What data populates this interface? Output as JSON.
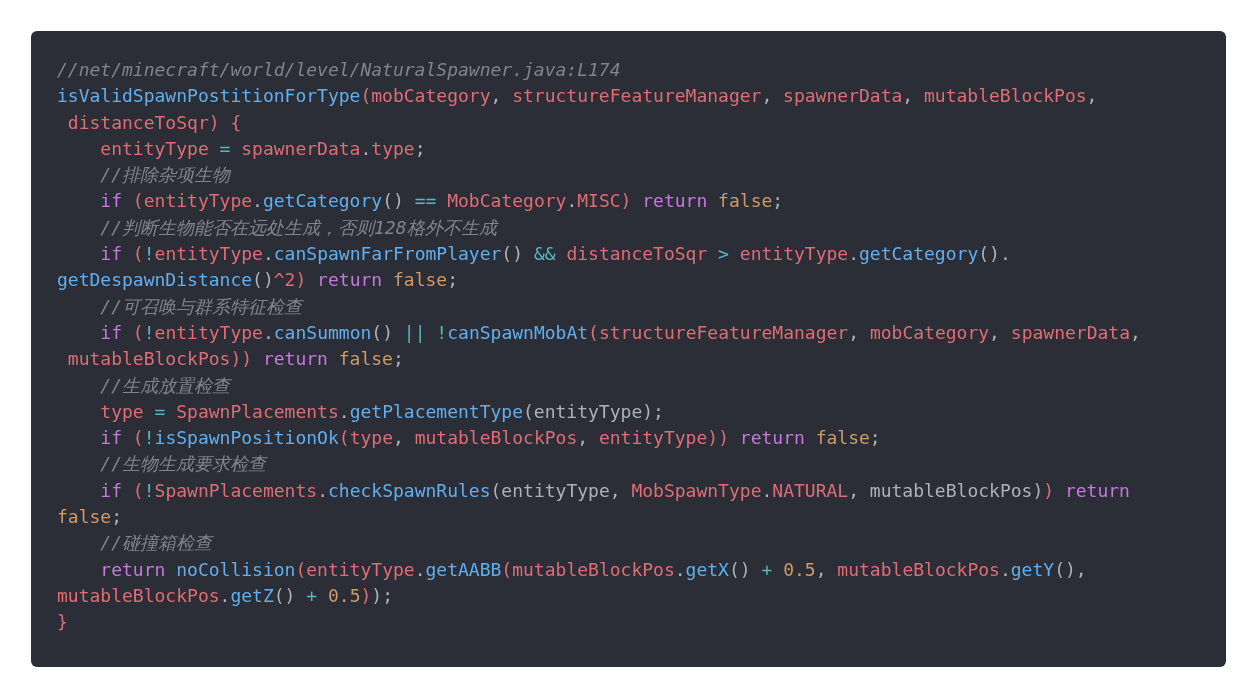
{
  "code_block": {
    "lines": [
      {
        "tokens": [
          {
            "kind": "comment",
            "text": "//net/minecraft/world/level/NaturalSpawner.java:L174"
          }
        ]
      },
      {
        "tokens": [
          {
            "kind": "fn",
            "text": "isValidSpawnPostitionForType"
          },
          {
            "kind": "var",
            "text": "(mobCategory"
          },
          {
            "kind": "plain",
            "text": ", "
          },
          {
            "kind": "var",
            "text": "structureFeatureManager"
          },
          {
            "kind": "plain",
            "text": ", "
          },
          {
            "kind": "var",
            "text": "spawnerData"
          },
          {
            "kind": "plain",
            "text": ", "
          },
          {
            "kind": "var",
            "text": "mutableBlockPos"
          },
          {
            "kind": "plain",
            "text": ","
          }
        ]
      },
      {
        "tokens": [
          {
            "kind": "var",
            "text": " distanceToSqr) {"
          }
        ]
      },
      {
        "tokens": [
          {
            "kind": "var",
            "text": "    entityType"
          },
          {
            "kind": "op",
            "text": " = "
          },
          {
            "kind": "var",
            "text": "spawnerData"
          },
          {
            "kind": "plain",
            "text": "."
          },
          {
            "kind": "var",
            "text": "type"
          },
          {
            "kind": "plain",
            "text": ";"
          }
        ]
      },
      {
        "tokens": [
          {
            "kind": "comment",
            "text": "    //排除杂项生物"
          }
        ]
      },
      {
        "tokens": [
          {
            "kind": "kw",
            "text": "    if"
          },
          {
            "kind": "var",
            "text": " (entityType"
          },
          {
            "kind": "plain",
            "text": "."
          },
          {
            "kind": "fn",
            "text": "getCategory"
          },
          {
            "kind": "plain",
            "text": "() "
          },
          {
            "kind": "op",
            "text": "=="
          },
          {
            "kind": "var",
            "text": " MobCategory"
          },
          {
            "kind": "plain",
            "text": "."
          },
          {
            "kind": "var",
            "text": "MISC)"
          },
          {
            "kind": "kw",
            "text": " return"
          },
          {
            "kind": "lit",
            "text": " false"
          },
          {
            "kind": "plain",
            "text": ";"
          }
        ]
      },
      {
        "tokens": [
          {
            "kind": "comment",
            "text": "    //判断生物能否在远处生成，否则128格外不生成"
          }
        ]
      },
      {
        "tokens": [
          {
            "kind": "kw",
            "text": "    if"
          },
          {
            "kind": "var",
            "text": " ("
          },
          {
            "kind": "op",
            "text": "!"
          },
          {
            "kind": "var",
            "text": "entityType"
          },
          {
            "kind": "plain",
            "text": "."
          },
          {
            "kind": "fn",
            "text": "canSpawnFarFromPlayer"
          },
          {
            "kind": "plain",
            "text": "() "
          },
          {
            "kind": "op",
            "text": "&&"
          },
          {
            "kind": "var",
            "text": " distanceToSqr"
          },
          {
            "kind": "op",
            "text": " > "
          },
          {
            "kind": "var",
            "text": "entityType"
          },
          {
            "kind": "plain",
            "text": "."
          },
          {
            "kind": "fn",
            "text": "getCategory"
          },
          {
            "kind": "plain",
            "text": "()."
          }
        ]
      },
      {
        "tokens": [
          {
            "kind": "fn",
            "text": "getDespawnDistance"
          },
          {
            "kind": "plain",
            "text": "()"
          },
          {
            "kind": "var",
            "text": "^2)"
          },
          {
            "kind": "kw",
            "text": " return"
          },
          {
            "kind": "lit",
            "text": " false"
          },
          {
            "kind": "plain",
            "text": ";"
          }
        ]
      },
      {
        "tokens": [
          {
            "kind": "comment",
            "text": "    //可召唤与群系特征检查"
          }
        ]
      },
      {
        "tokens": [
          {
            "kind": "kw",
            "text": "    if"
          },
          {
            "kind": "var",
            "text": " ("
          },
          {
            "kind": "op",
            "text": "!"
          },
          {
            "kind": "var",
            "text": "entityType"
          },
          {
            "kind": "plain",
            "text": "."
          },
          {
            "kind": "fn",
            "text": "canSummon"
          },
          {
            "kind": "plain",
            "text": "() "
          },
          {
            "kind": "op",
            "text": "||"
          },
          {
            "kind": "op",
            "text": " !"
          },
          {
            "kind": "fn",
            "text": "canSpawnMobAt"
          },
          {
            "kind": "var",
            "text": "(structureFeatureManager"
          },
          {
            "kind": "plain",
            "text": ", "
          },
          {
            "kind": "var",
            "text": "mobCategory"
          },
          {
            "kind": "plain",
            "text": ", "
          },
          {
            "kind": "var",
            "text": "spawnerData"
          },
          {
            "kind": "plain",
            "text": ","
          }
        ]
      },
      {
        "tokens": [
          {
            "kind": "var",
            "text": " mutableBlockPos))"
          },
          {
            "kind": "kw",
            "text": " return"
          },
          {
            "kind": "lit",
            "text": " false"
          },
          {
            "kind": "plain",
            "text": ";"
          }
        ]
      },
      {
        "tokens": [
          {
            "kind": "comment",
            "text": "    //生成放置检查"
          }
        ]
      },
      {
        "tokens": [
          {
            "kind": "var",
            "text": "    type"
          },
          {
            "kind": "op",
            "text": " = "
          },
          {
            "kind": "var",
            "text": "SpawnPlacements"
          },
          {
            "kind": "plain",
            "text": "."
          },
          {
            "kind": "fn",
            "text": "getPlacementType"
          },
          {
            "kind": "plain",
            "text": "(entityType);"
          }
        ]
      },
      {
        "tokens": [
          {
            "kind": "kw",
            "text": "    if"
          },
          {
            "kind": "var",
            "text": " ("
          },
          {
            "kind": "op",
            "text": "!"
          },
          {
            "kind": "fn",
            "text": "isSpawnPositionOk"
          },
          {
            "kind": "var",
            "text": "(type"
          },
          {
            "kind": "plain",
            "text": ", "
          },
          {
            "kind": "var",
            "text": "mutableBlockPos"
          },
          {
            "kind": "plain",
            "text": ", "
          },
          {
            "kind": "var",
            "text": "entityType))"
          },
          {
            "kind": "kw",
            "text": " return"
          },
          {
            "kind": "lit",
            "text": " false"
          },
          {
            "kind": "plain",
            "text": ";"
          }
        ]
      },
      {
        "tokens": [
          {
            "kind": "comment",
            "text": "    //生物生成要求检查"
          }
        ]
      },
      {
        "tokens": [
          {
            "kind": "kw",
            "text": "    if"
          },
          {
            "kind": "var",
            "text": " ("
          },
          {
            "kind": "op",
            "text": "!"
          },
          {
            "kind": "var",
            "text": "SpawnPlacements"
          },
          {
            "kind": "plain",
            "text": "."
          },
          {
            "kind": "fn",
            "text": "checkSpawnRules"
          },
          {
            "kind": "plain",
            "text": "(entityType, "
          },
          {
            "kind": "var",
            "text": "MobSpawnType"
          },
          {
            "kind": "plain",
            "text": "."
          },
          {
            "kind": "var",
            "text": "NATURAL"
          },
          {
            "kind": "plain",
            "text": ", mutableBlockPos)"
          },
          {
            "kind": "var",
            "text": ")"
          },
          {
            "kind": "kw",
            "text": " return"
          }
        ]
      },
      {
        "tokens": [
          {
            "kind": "lit",
            "text": "false"
          },
          {
            "kind": "plain",
            "text": ";"
          }
        ]
      },
      {
        "tokens": [
          {
            "kind": "comment",
            "text": "    //碰撞箱检查"
          }
        ]
      },
      {
        "tokens": [
          {
            "kind": "kw",
            "text": "    return "
          },
          {
            "kind": "fn",
            "text": "noCollision"
          },
          {
            "kind": "var",
            "text": "(entityType"
          },
          {
            "kind": "plain",
            "text": "."
          },
          {
            "kind": "fn",
            "text": "getAABB"
          },
          {
            "kind": "var",
            "text": "(mutableBlockPos"
          },
          {
            "kind": "plain",
            "text": "."
          },
          {
            "kind": "fn",
            "text": "getX"
          },
          {
            "kind": "plain",
            "text": "() "
          },
          {
            "kind": "op",
            "text": "+"
          },
          {
            "kind": "lit",
            "text": " 0.5"
          },
          {
            "kind": "plain",
            "text": ", "
          },
          {
            "kind": "var",
            "text": "mutableBlockPos"
          },
          {
            "kind": "plain",
            "text": "."
          },
          {
            "kind": "fn",
            "text": "getY"
          },
          {
            "kind": "plain",
            "text": "(),"
          }
        ]
      },
      {
        "tokens": [
          {
            "kind": "var",
            "text": "mutableBlockPos"
          },
          {
            "kind": "plain",
            "text": "."
          },
          {
            "kind": "fn",
            "text": "getZ"
          },
          {
            "kind": "plain",
            "text": "() "
          },
          {
            "kind": "op",
            "text": "+"
          },
          {
            "kind": "lit",
            "text": " 0.5"
          },
          {
            "kind": "var",
            "text": ")"
          },
          {
            "kind": "plain",
            "text": ");"
          }
        ]
      },
      {
        "tokens": [
          {
            "kind": "var",
            "text": "}"
          }
        ]
      }
    ]
  }
}
